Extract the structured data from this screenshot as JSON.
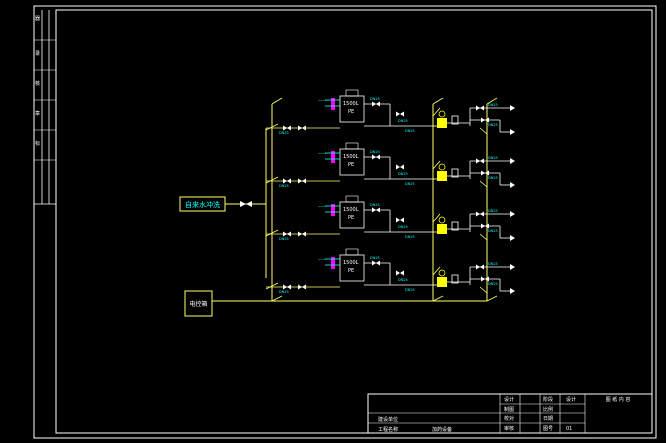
{
  "colors": {
    "background": "#000000",
    "frame": "#ffffff",
    "pipe": "#ffff66",
    "label": "#00ffff",
    "accent": "#ff00ff",
    "valve": "#ffff00",
    "text": "#ffffff"
  },
  "left_strip": {
    "labels": [
      "器",
      "录",
      "核",
      "章",
      "标"
    ]
  },
  "source_box": {
    "label": "自来水冲洗"
  },
  "pump_box": {
    "label": "电控箱"
  },
  "tanks": [
    {
      "line1": "1500L",
      "line2": "PE"
    },
    {
      "line1": "1500L",
      "line2": "PE"
    },
    {
      "line1": "1500L",
      "line2": "PE"
    },
    {
      "line1": "1500L",
      "line2": "PE"
    }
  ],
  "tag_text": "DN25",
  "title_block": {
    "left_r1": "建设单位",
    "left_r2": "工程名称",
    "proj_name": "加药设备",
    "role_designer": "设计",
    "role_drafter": "制图",
    "role_checker": "校对",
    "role_reviewer": "审核",
    "c_stage": "阶段",
    "c_stage_v": "设计",
    "c_scale": "比例",
    "c_date": "日期",
    "c_drawno": "图号",
    "c_drawno_v": "01",
    "drawing_title": "图 纸 内 容"
  }
}
